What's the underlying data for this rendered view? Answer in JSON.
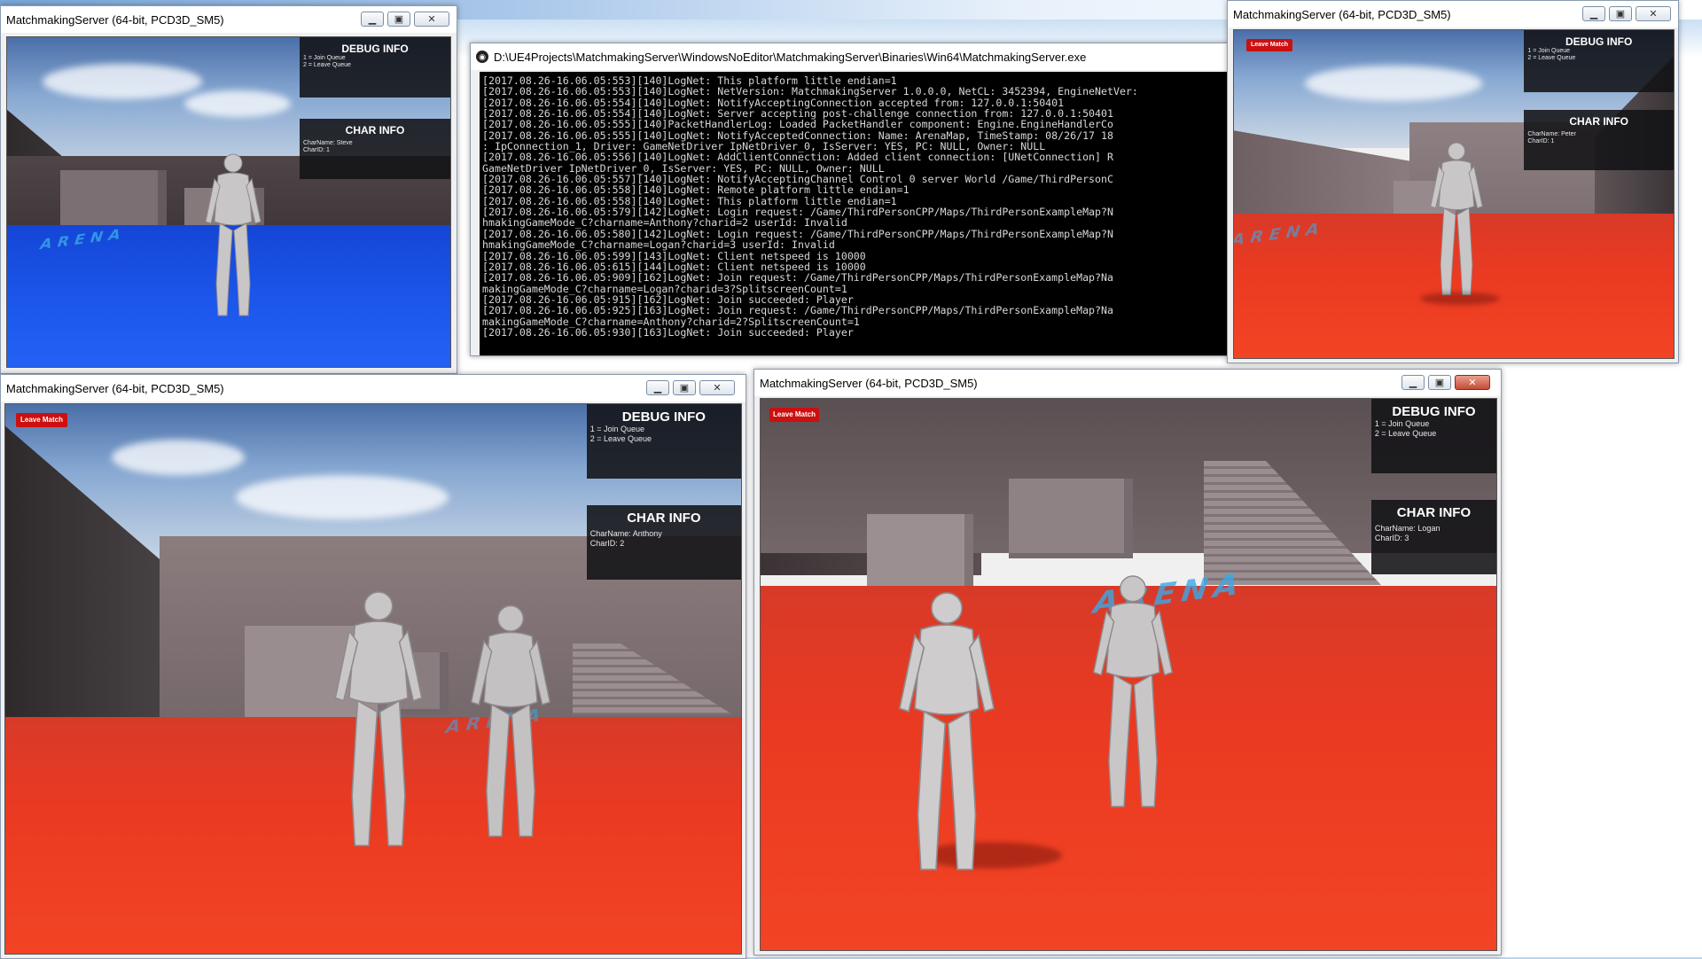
{
  "windows": [
    {
      "id": "w1",
      "title": "MatchmakingServer (64-bit, PCD3D_SM5)",
      "charname": "CharName: Steve",
      "charid": "CharID: 1"
    },
    {
      "id": "w2",
      "title": "MatchmakingServer (64-bit, PCD3D_SM5)",
      "leave": "Leave Match",
      "charname": "CharName: Peter",
      "charid": "CharID: 1"
    },
    {
      "id": "w3",
      "title": "MatchmakingServer (64-bit, PCD3D_SM5)",
      "leave": "Leave Match",
      "charname": "CharName: Anthony",
      "charid": "CharID: 2"
    },
    {
      "id": "w4",
      "title": "MatchmakingServer (64-bit, PCD3D_SM5)",
      "leave": "Leave Match",
      "charname": "CharName: Logan",
      "charid": "CharID: 3"
    }
  ],
  "hud": {
    "debug_title": "DEBUG INFO",
    "join": "1 = Join Queue",
    "leave": "2 = Leave Queue",
    "char_title": "CHAR INFO"
  },
  "floor_text": "ARENA",
  "console": {
    "title": "D:\\UE4Projects\\MatchmakingServer\\WindowsNoEditor\\MatchmakingServer\\Binaries\\Win64\\MatchmakingServer.exe",
    "lines": [
      "[2017.08.26-16.06.05:553][140]LogNet: This platform little endian=1",
      "[2017.08.26-16.06.05:553][140]LogNet: NetVersion: MatchmakingServer 1.0.0.0, NetCL: 3452394, EngineNetVer:",
      "[2017.08.26-16.06.05:554][140]LogNet: NotifyAcceptingConnection accepted from: 127.0.0.1:50401",
      "[2017.08.26-16.06.05:554][140]LogNet: Server accepting post-challenge connection from: 127.0.0.1:50401",
      "[2017.08.26-16.06.05:555][140]PacketHandlerLog: Loaded PacketHandler component: Engine.EngineHandlerCo",
      "[2017.08.26-16.06.05:555][140]LogNet: NotifyAcceptedConnection: Name: ArenaMap, TimeStamp: 08/26/17 18",
      ": IpConnection_1, Driver: GameNetDriver IpNetDriver_0, IsServer: YES, PC: NULL, Owner: NULL",
      "[2017.08.26-16.06.05:556][140]LogNet: AddClientConnection: Added client connection: [UNetConnection] R",
      "GameNetDriver IpNetDriver_0, IsServer: YES, PC: NULL, Owner: NULL",
      "[2017.08.26-16.06.05:557][140]LogNet: NotifyAcceptingChannel Control 0 server World /Game/ThirdPersonC",
      "[2017.08.26-16.06.05:558][140]LogNet: Remote platform little endian=1",
      "[2017.08.26-16.06.05:558][140]LogNet: This platform little endian=1",
      "[2017.08.26-16.06.05:579][142]LogNet: Login request: /Game/ThirdPersonCPP/Maps/ThirdPersonExampleMap?N",
      "hmakingGameMode_C?charname=Anthony?charid=2 userId: Invalid",
      "[2017.08.26-16.06.05:580][142]LogNet: Login request: /Game/ThirdPersonCPP/Maps/ThirdPersonExampleMap?N",
      "hmakingGameMode_C?charname=Logan?charid=3 userId: Invalid",
      "[2017.08.26-16.06.05:599][143]LogNet: Client netspeed is 10000",
      "[2017.08.26-16.06.05:615][144]LogNet: Client netspeed is 10000",
      "[2017.08.26-16.06.05:909][162]LogNet: Join request: /Game/ThirdPersonCPP/Maps/ThirdPersonExampleMap?Na",
      "makingGameMode_C?charname=Logan?charid=3?SplitscreenCount=1",
      "[2017.08.26-16.06.05:915][162]LogNet: Join succeeded: Player",
      "[2017.08.26-16.06.05:925][163]LogNet: Join request: /Game/ThirdPersonCPP/Maps/ThirdPersonExampleMap?Na",
      "makingGameMode_C?charname=Anthony?charid=2?SplitscreenCount=1",
      "[2017.08.26-16.06.05:930][163]LogNet: Join succeeded: Player"
    ]
  },
  "icons": {
    "minimize": "minimize-icon",
    "maximize": "maximize-icon",
    "close": "close-icon",
    "console": "console-app-icon"
  },
  "colors": {
    "leave_button": "#cc0f0f",
    "floor_red": "#ea3a22",
    "floor_blue": "#1d58ee",
    "hud_bg": "#121216"
  }
}
